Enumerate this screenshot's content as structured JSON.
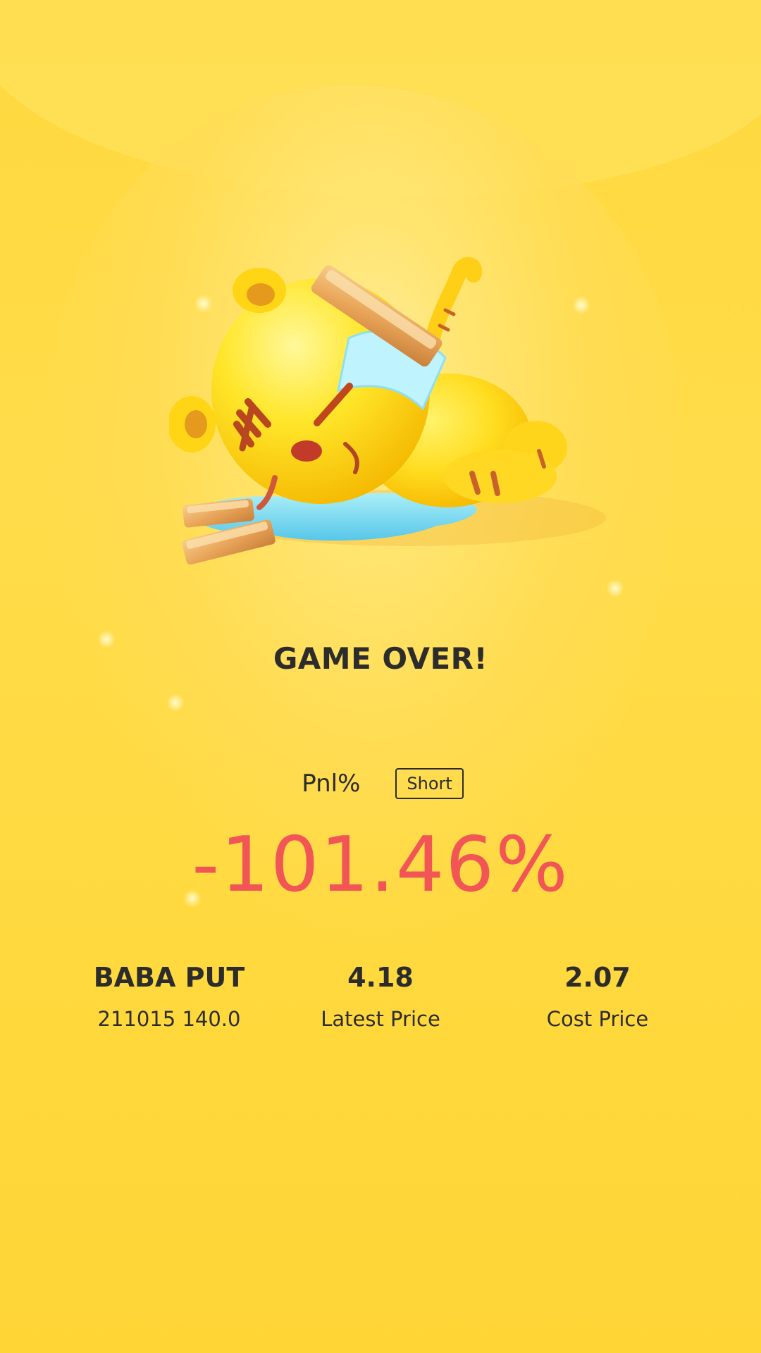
{
  "result": {
    "title": "GAME OVER!",
    "pnl_label": "Pnl%",
    "position_tag": "Short",
    "pnl_value": "-101.46%"
  },
  "stats": {
    "contract_name": "BABA PUT",
    "contract_detail": "211015 140.0",
    "latest_price_value": "4.18",
    "latest_price_label": "Latest Price",
    "cost_price_value": "2.07",
    "cost_price_label": "Cost Price"
  },
  "colors": {
    "background": "#ffd83d",
    "loss_red": "#f25555",
    "text_dark": "#2c2c2c"
  },
  "illustration": {
    "icon": "fallen-tiger-mascot-with-gold-bars-icon"
  }
}
